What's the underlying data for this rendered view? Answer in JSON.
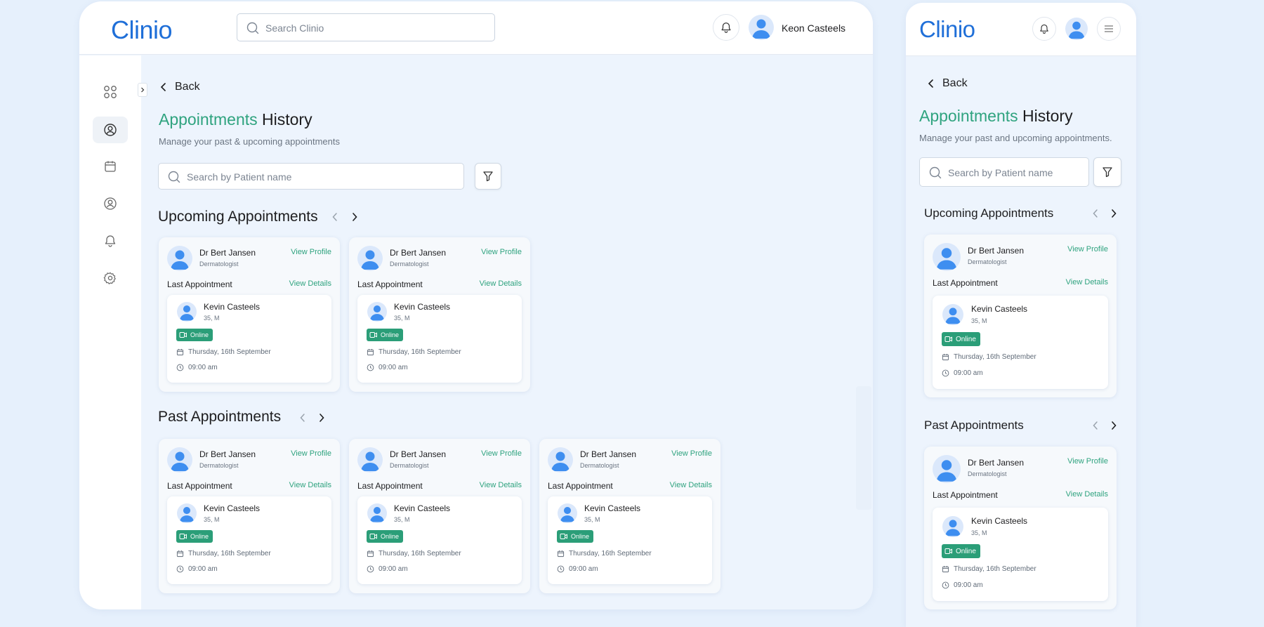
{
  "app": {
    "logo": "Clinio"
  },
  "header": {
    "search_placeholder": "Search Clinio",
    "user_name": "Keon Casteels"
  },
  "sidebar": {
    "items": [
      {
        "icon": "dashboard-icon",
        "active": false
      },
      {
        "icon": "user-circle-icon",
        "active": true
      },
      {
        "icon": "calendar-icon",
        "active": false
      },
      {
        "icon": "user-badge-icon",
        "active": false
      },
      {
        "icon": "bell-icon",
        "active": false
      },
      {
        "icon": "gear-icon",
        "active": false
      }
    ]
  },
  "page": {
    "back_label": "Back",
    "title_highlight": "Appointments",
    "title_rest": "History",
    "subtitle": "Manage your past & upcoming appointments",
    "search_placeholder": "Search by Patient name"
  },
  "mobile_page": {
    "subtitle": "Manage your past and upcoming appointments."
  },
  "sections": {
    "upcoming_title": "Upcoming Appointments",
    "past_title": "Past Appointments"
  },
  "card": {
    "doctor_name": "Dr Bert Jansen",
    "doctor_specialty": "Dermatologist",
    "view_profile": "View Profile",
    "last_appointment": "Last Appointment",
    "view_details": "View Details",
    "patient_name": "Kevin Casteels",
    "patient_meta": "35, M",
    "mode": "Online",
    "date": "Thursday, 16th September",
    "time": "09:00 am"
  },
  "colors": {
    "brand_blue": "#1f6fd8",
    "accent_green": "#2fa37f",
    "badge_green": "#2b9e78",
    "background": "#e6f0fc"
  }
}
